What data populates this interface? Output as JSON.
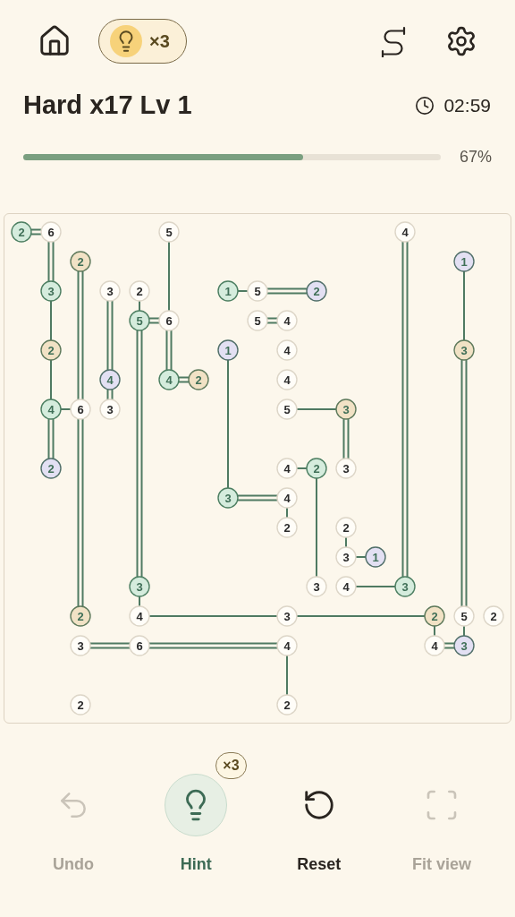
{
  "header": {
    "hint_count": "×3"
  },
  "level": {
    "title": "Hard x17 Lv 1",
    "timer": "02:59"
  },
  "progress": {
    "level": 0.67,
    "reading": "67%"
  },
  "board": {
    "rows": [
      {
        "cells": [
          {
            "kind": "island",
            "value": "2",
            "color": "#d5ecdd",
            "right": {
              "kind": "double"
            }
          },
          {
            "kind": "island",
            "value": "6",
            "color": "#fffdf8",
            "down": {
              "kind": "double"
            }
          },
          {
            "kind": "gap"
          },
          {
            "kind": "gap"
          },
          {
            "kind": "gap"
          },
          {
            "kind": "island",
            "value": "5",
            "color": "#fffdf8",
            "down": {
              "kind": "single"
            }
          },
          {
            "kind": "gap"
          },
          {
            "kind": "gap"
          },
          {
            "kind": "gap"
          },
          {
            "kind": "gap"
          },
          {
            "kind": "gap"
          },
          {
            "kind": "gap"
          },
          {
            "kind": "gap"
          },
          {
            "kind": "island",
            "value": "4",
            "color": "#fffdf8",
            "down": {
              "kind": "double"
            }
          },
          {
            "kind": "gap"
          },
          {
            "kind": "gap"
          },
          {
            "kind": "gap"
          }
        ]
      },
      {
        "cells": [
          {
            "kind": "gap"
          },
          {
            "kind": "gap"
          },
          {
            "kind": "island",
            "value": "2",
            "color": "#f1e2c5",
            "down": {
              "kind": "double"
            }
          },
          {
            "kind": "gap"
          },
          {
            "kind": "gap"
          },
          {
            "kind": "gap"
          },
          {
            "kind": "gap"
          },
          {
            "kind": "gap"
          },
          {
            "kind": "gap"
          },
          {
            "kind": "gap"
          },
          {
            "kind": "gap"
          },
          {
            "kind": "gap"
          },
          {
            "kind": "gap"
          },
          {
            "kind": "gap"
          },
          {
            "kind": "gap"
          },
          {
            "kind": "island",
            "value": "1",
            "color": "#e3e0f3",
            "down": {
              "kind": "single"
            }
          },
          {
            "kind": "gap"
          }
        ]
      },
      {
        "cells": [
          {
            "kind": "gap"
          },
          {
            "kind": "island",
            "value": "3",
            "color": "#d5ecdd",
            "down": {
              "kind": "single"
            }
          },
          {
            "kind": "gap"
          },
          {
            "kind": "island",
            "value": "3",
            "color": "#fffdf8",
            "down": {
              "kind": "double"
            }
          },
          {
            "kind": "island",
            "value": "2",
            "color": "#fffdf8",
            "down": {
              "kind": "single"
            }
          },
          {
            "kind": "gap"
          },
          {
            "kind": "gap"
          },
          {
            "kind": "island",
            "value": "1",
            "color": "#d5ecdd",
            "right": {
              "kind": "single"
            }
          },
          {
            "kind": "island",
            "value": "5",
            "color": "#fffdf8",
            "right": {
              "kind": "double"
            }
          },
          {
            "kind": "gap"
          },
          {
            "kind": "island",
            "value": "2",
            "color": "#e3e0f3"
          },
          {
            "kind": "gap"
          },
          {
            "kind": "gap"
          },
          {
            "kind": "gap"
          },
          {
            "kind": "gap"
          },
          {
            "kind": "gap"
          },
          {
            "kind": "gap"
          }
        ]
      },
      {
        "cells": [
          {
            "kind": "gap"
          },
          {
            "kind": "gap"
          },
          {
            "kind": "gap"
          },
          {
            "kind": "gap"
          },
          {
            "kind": "island",
            "value": "5",
            "color": "#d5ecdd",
            "right": {
              "kind": "double"
            },
            "down": {
              "kind": "double"
            }
          },
          {
            "kind": "island",
            "value": "6",
            "color": "#fffdf8",
            "down": {
              "kind": "double"
            }
          },
          {
            "kind": "gap"
          },
          {
            "kind": "gap"
          },
          {
            "kind": "island",
            "value": "5",
            "color": "#fffdf8",
            "right": {
              "kind": "double"
            }
          },
          {
            "kind": "island",
            "value": "4",
            "color": "#fffdf8"
          },
          {
            "kind": "gap"
          },
          {
            "kind": "gap"
          },
          {
            "kind": "gap"
          },
          {
            "kind": "gap"
          },
          {
            "kind": "gap"
          },
          {
            "kind": "gap"
          },
          {
            "kind": "gap"
          }
        ]
      },
      {
        "cells": [
          {
            "kind": "gap"
          },
          {
            "kind": "island",
            "value": "2",
            "color": "#f1e2c5",
            "down": {
              "kind": "single"
            }
          },
          {
            "kind": "gap"
          },
          {
            "kind": "gap"
          },
          {
            "kind": "gap"
          },
          {
            "kind": "gap"
          },
          {
            "kind": "gap"
          },
          {
            "kind": "island",
            "value": "1",
            "color": "#e3e0f3",
            "down": {
              "kind": "single"
            }
          },
          {
            "kind": "gap"
          },
          {
            "kind": "island",
            "value": "4",
            "color": "#fffdf8"
          },
          {
            "kind": "gap"
          },
          {
            "kind": "gap"
          },
          {
            "kind": "gap"
          },
          {
            "kind": "gap"
          },
          {
            "kind": "gap"
          },
          {
            "kind": "island",
            "value": "3",
            "color": "#f1e2c5",
            "down": {
              "kind": "double"
            }
          },
          {
            "kind": "gap"
          }
        ]
      },
      {
        "cells": [
          {
            "kind": "gap"
          },
          {
            "kind": "gap"
          },
          {
            "kind": "gap"
          },
          {
            "kind": "island",
            "value": "4",
            "color": "#e3e0f3",
            "down": {
              "kind": "double"
            }
          },
          {
            "kind": "gap"
          },
          {
            "kind": "island",
            "value": "4",
            "color": "#d5ecdd",
            "right": {
              "kind": "double"
            }
          },
          {
            "kind": "island",
            "value": "2",
            "color": "#f1e2c5"
          },
          {
            "kind": "gap"
          },
          {
            "kind": "gap"
          },
          {
            "kind": "island",
            "value": "4",
            "color": "#fffdf8"
          },
          {
            "kind": "gap"
          },
          {
            "kind": "gap"
          },
          {
            "kind": "gap"
          },
          {
            "kind": "gap"
          },
          {
            "kind": "gap"
          },
          {
            "kind": "gap"
          },
          {
            "kind": "gap"
          }
        ]
      },
      {
        "cells": [
          {
            "kind": "gap"
          },
          {
            "kind": "island",
            "value": "4",
            "color": "#d5ecdd",
            "right": {
              "kind": "single"
            },
            "down": {
              "kind": "double"
            }
          },
          {
            "kind": "island",
            "value": "6",
            "color": "#fffdf8",
            "down": {
              "kind": "double"
            }
          },
          {
            "kind": "island",
            "value": "3",
            "color": "#fffdf8"
          },
          {
            "kind": "gap"
          },
          {
            "kind": "gap"
          },
          {
            "kind": "gap"
          },
          {
            "kind": "gap"
          },
          {
            "kind": "gap"
          },
          {
            "kind": "island",
            "value": "5",
            "color": "#fffdf8",
            "right": {
              "kind": "single"
            }
          },
          {
            "kind": "gap"
          },
          {
            "kind": "island",
            "value": "3",
            "color": "#f1e2c5",
            "down": {
              "kind": "double"
            }
          },
          {
            "kind": "gap"
          },
          {
            "kind": "gap"
          },
          {
            "kind": "gap"
          },
          {
            "kind": "gap"
          },
          {
            "kind": "gap"
          }
        ]
      },
      {
        "cells": [
          {
            "kind": "gap"
          },
          {
            "kind": "gap"
          },
          {
            "kind": "gap"
          },
          {
            "kind": "gap"
          },
          {
            "kind": "gap"
          },
          {
            "kind": "gap"
          },
          {
            "kind": "gap"
          },
          {
            "kind": "gap"
          },
          {
            "kind": "gap"
          },
          {
            "kind": "gap"
          },
          {
            "kind": "gap"
          },
          {
            "kind": "gap"
          },
          {
            "kind": "gap"
          },
          {
            "kind": "gap"
          },
          {
            "kind": "gap"
          },
          {
            "kind": "gap"
          },
          {
            "kind": "gap"
          }
        ]
      },
      {
        "cells": [
          {
            "kind": "gap"
          },
          {
            "kind": "island",
            "value": "2",
            "color": "#e3e0f3"
          },
          {
            "kind": "gap"
          },
          {
            "kind": "gap"
          },
          {
            "kind": "gap"
          },
          {
            "kind": "gap"
          },
          {
            "kind": "gap"
          },
          {
            "kind": "gap"
          },
          {
            "kind": "gap"
          },
          {
            "kind": "island",
            "value": "4",
            "color": "#fffdf8",
            "right": {
              "kind": "single"
            }
          },
          {
            "kind": "island",
            "value": "2",
            "color": "#d5ecdd",
            "down": {
              "kind": "single"
            }
          },
          {
            "kind": "island",
            "value": "3",
            "color": "#fffdf8"
          },
          {
            "kind": "gap"
          },
          {
            "kind": "gap"
          },
          {
            "kind": "gap"
          },
          {
            "kind": "gap"
          },
          {
            "kind": "gap"
          }
        ]
      },
      {
        "cells": [
          {
            "kind": "gap"
          },
          {
            "kind": "gap"
          },
          {
            "kind": "gap"
          },
          {
            "kind": "gap"
          },
          {
            "kind": "gap"
          },
          {
            "kind": "gap"
          },
          {
            "kind": "gap"
          },
          {
            "kind": "island",
            "value": "3",
            "color": "#d5ecdd",
            "right": {
              "kind": "double"
            }
          },
          {
            "kind": "gap"
          },
          {
            "kind": "island",
            "value": "4",
            "color": "#fffdf8",
            "down": {
              "kind": "single"
            }
          },
          {
            "kind": "gap"
          },
          {
            "kind": "gap"
          },
          {
            "kind": "gap"
          },
          {
            "kind": "gap"
          },
          {
            "kind": "gap"
          },
          {
            "kind": "gap"
          },
          {
            "kind": "gap"
          }
        ]
      },
      {
        "cells": [
          {
            "kind": "gap"
          },
          {
            "kind": "gap"
          },
          {
            "kind": "gap"
          },
          {
            "kind": "gap"
          },
          {
            "kind": "gap"
          },
          {
            "kind": "gap"
          },
          {
            "kind": "gap"
          },
          {
            "kind": "gap"
          },
          {
            "kind": "gap"
          },
          {
            "kind": "island",
            "value": "2",
            "color": "#fffdf8"
          },
          {
            "kind": "gap"
          },
          {
            "kind": "island",
            "value": "2",
            "color": "#fffdf8",
            "down": {
              "kind": "single"
            }
          },
          {
            "kind": "gap"
          },
          {
            "kind": "gap"
          },
          {
            "kind": "gap"
          },
          {
            "kind": "gap"
          },
          {
            "kind": "gap"
          }
        ]
      },
      {
        "cells": [
          {
            "kind": "gap"
          },
          {
            "kind": "gap"
          },
          {
            "kind": "gap"
          },
          {
            "kind": "gap"
          },
          {
            "kind": "gap"
          },
          {
            "kind": "gap"
          },
          {
            "kind": "gap"
          },
          {
            "kind": "gap"
          },
          {
            "kind": "gap"
          },
          {
            "kind": "gap"
          },
          {
            "kind": "gap"
          },
          {
            "kind": "island",
            "value": "3",
            "color": "#fffdf8",
            "right": {
              "kind": "single"
            }
          },
          {
            "kind": "island",
            "value": "1",
            "color": "#e3e0f3"
          },
          {
            "kind": "gap"
          },
          {
            "kind": "gap"
          },
          {
            "kind": "gap"
          },
          {
            "kind": "gap"
          }
        ]
      },
      {
        "cells": [
          {
            "kind": "gap"
          },
          {
            "kind": "gap"
          },
          {
            "kind": "gap"
          },
          {
            "kind": "gap"
          },
          {
            "kind": "island",
            "value": "3",
            "color": "#d5ecdd",
            "down": {
              "kind": "single"
            }
          },
          {
            "kind": "gap"
          },
          {
            "kind": "gap"
          },
          {
            "kind": "gap"
          },
          {
            "kind": "gap"
          },
          {
            "kind": "gap"
          },
          {
            "kind": "island",
            "value": "3",
            "color": "#fffdf8"
          },
          {
            "kind": "island",
            "value": "4",
            "color": "#fffdf8",
            "right": {
              "kind": "single"
            }
          },
          {
            "kind": "gap"
          },
          {
            "kind": "island",
            "value": "3",
            "color": "#d5ecdd"
          },
          {
            "kind": "gap"
          },
          {
            "kind": "gap"
          },
          {
            "kind": "gap"
          }
        ]
      },
      {
        "cells": [
          {
            "kind": "gap"
          },
          {
            "kind": "gap"
          },
          {
            "kind": "island",
            "value": "2",
            "color": "#f1e2c5"
          },
          {
            "kind": "gap"
          },
          {
            "kind": "island",
            "value": "4",
            "color": "#fffdf8",
            "right": {
              "kind": "single"
            }
          },
          {
            "kind": "gap"
          },
          {
            "kind": "gap"
          },
          {
            "kind": "gap"
          },
          {
            "kind": "gap"
          },
          {
            "kind": "island",
            "value": "3",
            "color": "#fffdf8",
            "right": {
              "kind": "single"
            }
          },
          {
            "kind": "gap"
          },
          {
            "kind": "gap"
          },
          {
            "kind": "gap"
          },
          {
            "kind": "gap"
          },
          {
            "kind": "island",
            "value": "2",
            "color": "#f1e2c5",
            "down": {
              "kind": "single"
            }
          },
          {
            "kind": "island",
            "value": "5",
            "color": "#fffdf8",
            "down": {
              "kind": "single"
            }
          },
          {
            "kind": "island",
            "value": "2",
            "color": "#fffdf8"
          }
        ]
      },
      {
        "cells": [
          {
            "kind": "gap"
          },
          {
            "kind": "gap"
          },
          {
            "kind": "island",
            "value": "3",
            "color": "#fffdf8",
            "right": {
              "kind": "double"
            }
          },
          {
            "kind": "gap"
          },
          {
            "kind": "island",
            "value": "6",
            "color": "#fffdf8",
            "right": {
              "kind": "double"
            }
          },
          {
            "kind": "gap"
          },
          {
            "kind": "gap"
          },
          {
            "kind": "gap"
          },
          {
            "kind": "gap"
          },
          {
            "kind": "island",
            "value": "4",
            "color": "#fffdf8",
            "down": {
              "kind": "single"
            }
          },
          {
            "kind": "gap"
          },
          {
            "kind": "gap"
          },
          {
            "kind": "gap"
          },
          {
            "kind": "gap"
          },
          {
            "kind": "island",
            "value": "4",
            "color": "#fffdf8",
            "right": {
              "kind": "double"
            }
          },
          {
            "kind": "island",
            "value": "3",
            "color": "#e3e0f3"
          },
          {
            "kind": "gap"
          }
        ]
      },
      {
        "cells": [
          {
            "kind": "gap"
          },
          {
            "kind": "gap"
          },
          {
            "kind": "gap"
          },
          {
            "kind": "gap"
          },
          {
            "kind": "gap"
          },
          {
            "kind": "gap"
          },
          {
            "kind": "gap"
          },
          {
            "kind": "gap"
          },
          {
            "kind": "gap"
          },
          {
            "kind": "gap"
          },
          {
            "kind": "gap"
          },
          {
            "kind": "gap"
          },
          {
            "kind": "gap"
          },
          {
            "kind": "gap"
          },
          {
            "kind": "gap"
          },
          {
            "kind": "gap"
          },
          {
            "kind": "gap"
          }
        ]
      },
      {
        "cells": [
          {
            "kind": "gap"
          },
          {
            "kind": "gap"
          },
          {
            "kind": "island",
            "value": "2",
            "color": "#fffdf8"
          },
          {
            "kind": "gap"
          },
          {
            "kind": "gap"
          },
          {
            "kind": "gap"
          },
          {
            "kind": "gap"
          },
          {
            "kind": "gap"
          },
          {
            "kind": "gap"
          },
          {
            "kind": "island",
            "value": "2",
            "color": "#fffdf8"
          },
          {
            "kind": "gap"
          },
          {
            "kind": "gap"
          },
          {
            "kind": "gap"
          },
          {
            "kind": "gap"
          },
          {
            "kind": "gap"
          },
          {
            "kind": "gap"
          },
          {
            "kind": "gap"
          }
        ]
      }
    ]
  },
  "toolbar": [
    {
      "kind": "undo",
      "label": "Undo",
      "disabled": true
    },
    {
      "kind": "hint",
      "label": "Hint",
      "disabled": false,
      "badge": "×3"
    },
    {
      "kind": "reset",
      "label": "Reset",
      "disabled": false
    },
    {
      "kind": "fit",
      "label": "Fit view",
      "disabled": true
    }
  ]
}
